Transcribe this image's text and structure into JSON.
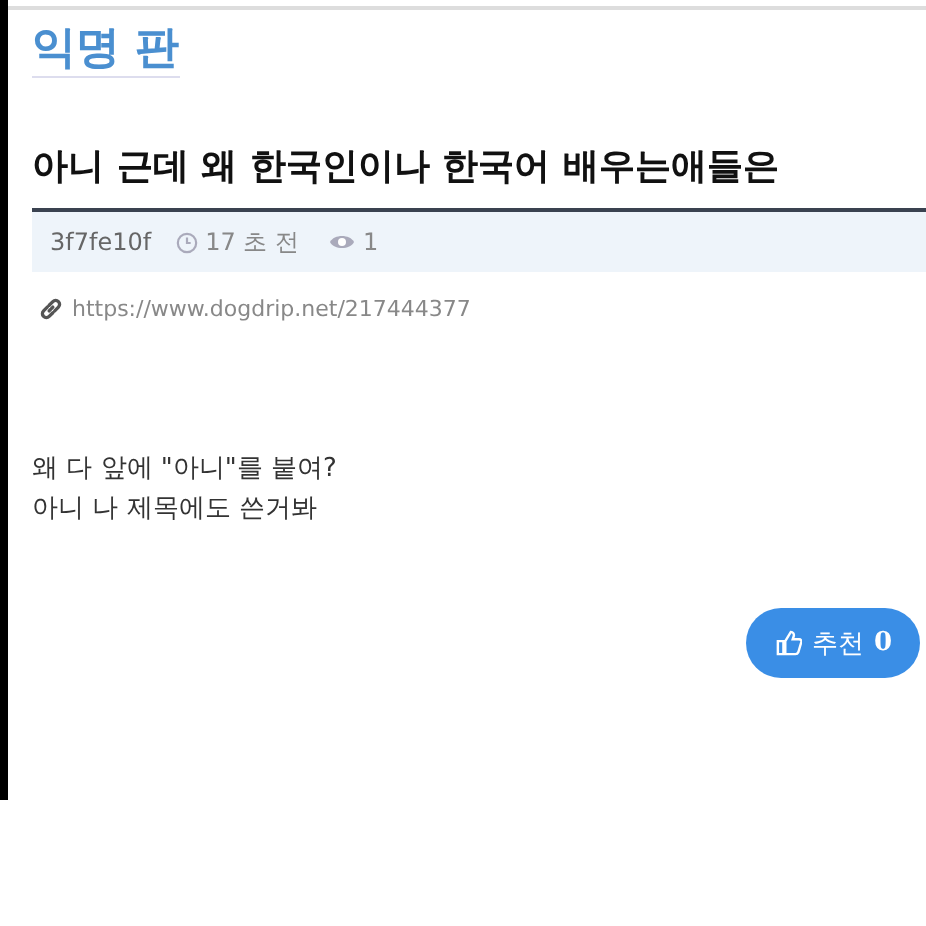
{
  "board": {
    "title": "익명 판"
  },
  "post": {
    "title": "아니 근데 왜 한국인이나 한국어 배우는애들은",
    "author": "3f7fe10f",
    "time": "17 초 전",
    "views": "1",
    "link": "https://www.dogdrip.net/217444377",
    "body": [
      "왜 다 앞에 \"아니\"를 붙여?",
      "아니 나 제목에도 쓴거봐"
    ]
  },
  "vote": {
    "label": "추천",
    "count": "0"
  }
}
